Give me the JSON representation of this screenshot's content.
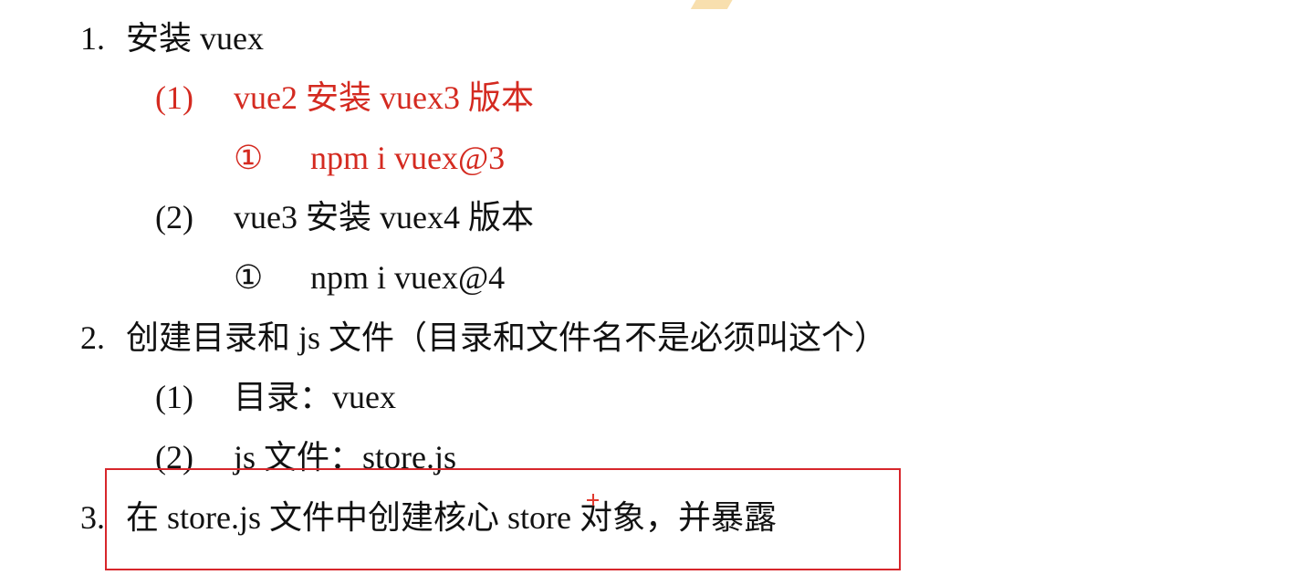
{
  "items": {
    "l1": {
      "num": "1.",
      "text": "安装 vuex"
    },
    "l1_1": {
      "num": "(1)",
      "text": "vue2 安装 vuex3 版本"
    },
    "l1_1_a": {
      "num": "①",
      "text": "npm i vuex@3"
    },
    "l1_2": {
      "num": "(2)",
      "text": "vue3 安装 vuex4 版本"
    },
    "l1_2_a": {
      "num": "①",
      "text": "npm i vuex@4"
    },
    "l2": {
      "num": "2.",
      "text": "创建目录和 js 文件（目录和文件名不是必须叫这个）"
    },
    "l2_1": {
      "num": "(1)",
      "text": "目录：vuex"
    },
    "l2_2": {
      "num": "(2)",
      "text": "js 文件：store.js"
    },
    "l3": {
      "num": "3.",
      "text": "在 store.js 文件中创建核心 store 对象，并暴露"
    }
  },
  "colors": {
    "text": "#111111",
    "emphasis": "#d42a20",
    "box_border": "#d7262b"
  },
  "icons": {
    "cursor": "crosshair-cursor-icon"
  }
}
